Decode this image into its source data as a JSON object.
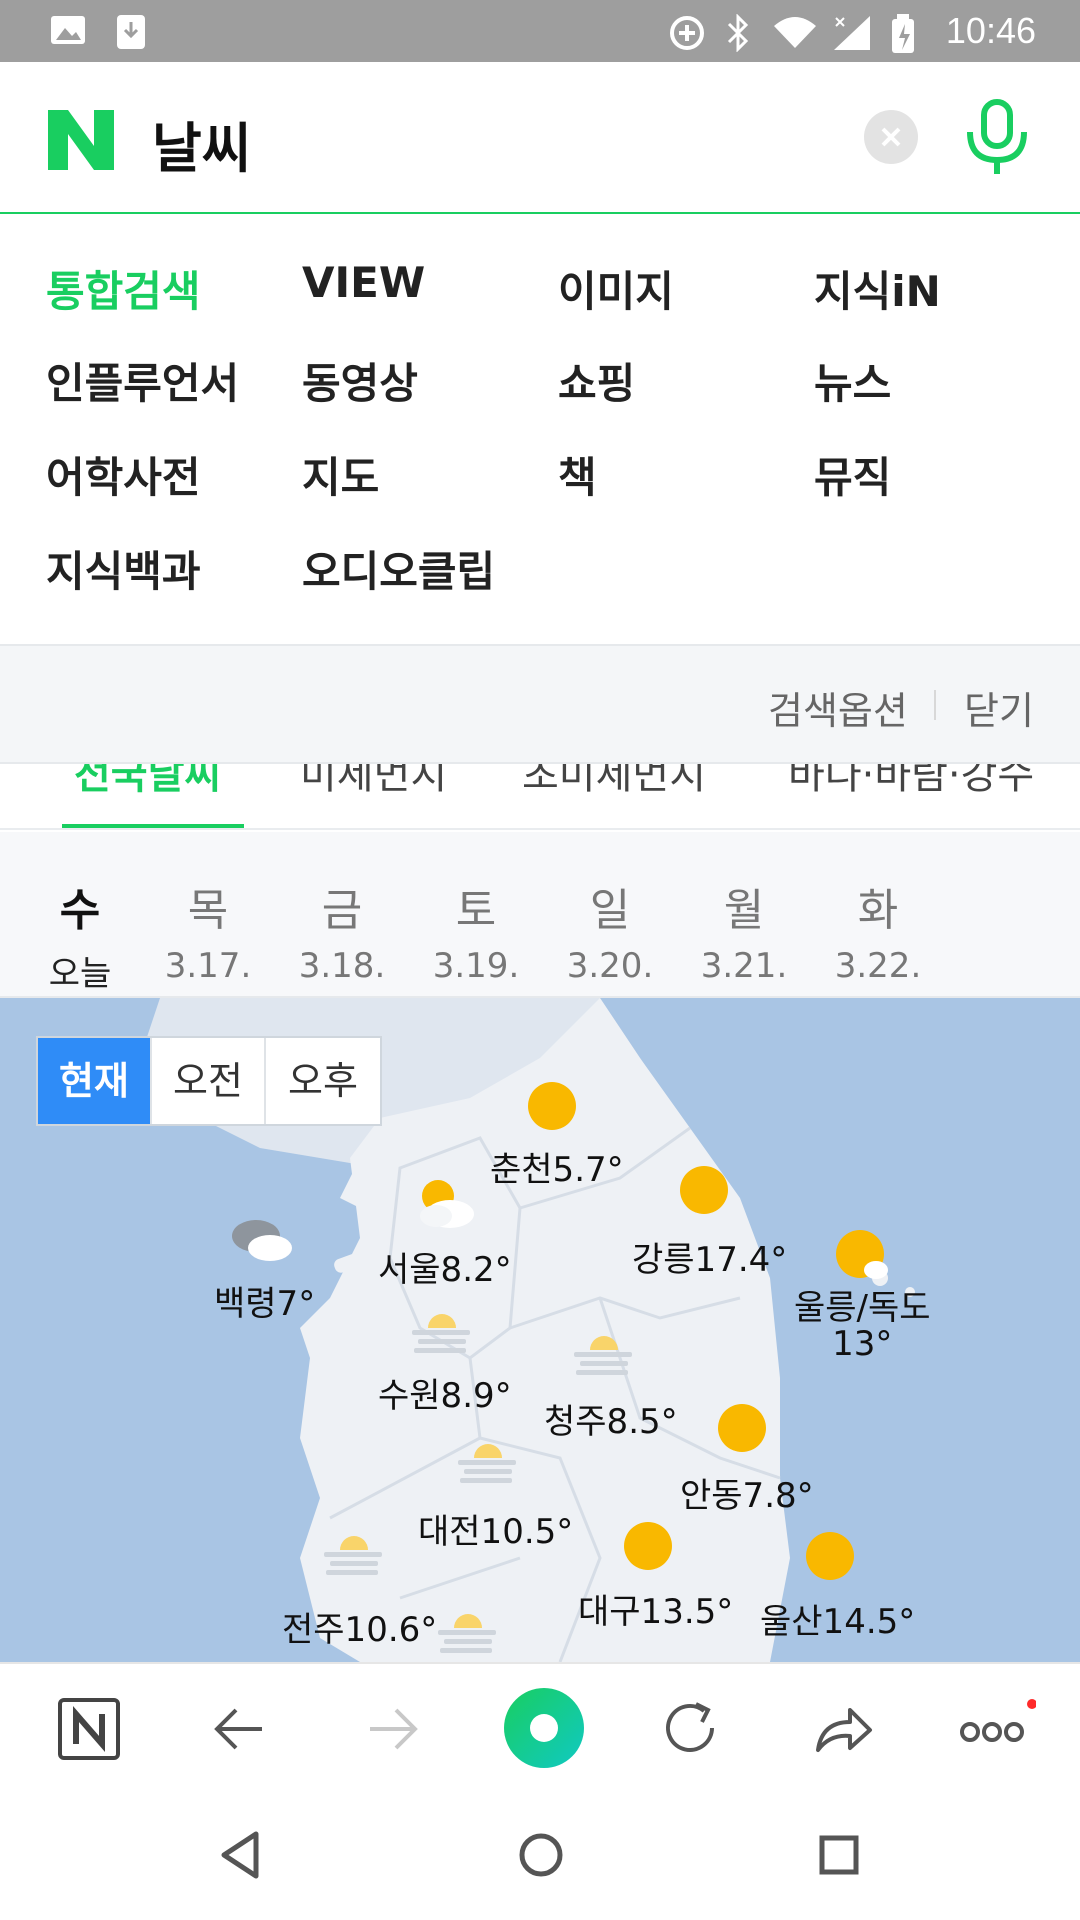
{
  "status_bar": {
    "time": "10:46"
  },
  "search": {
    "query": "날씨"
  },
  "categories": [
    {
      "label": "통합검색",
      "active": true
    },
    {
      "label": "VIEW"
    },
    {
      "label": "이미지"
    },
    {
      "label": "지식iN"
    },
    {
      "label": "인플루언서"
    },
    {
      "label": "동영상"
    },
    {
      "label": "쇼핑"
    },
    {
      "label": "뉴스"
    },
    {
      "label": "어학사전"
    },
    {
      "label": "지도"
    },
    {
      "label": "책"
    },
    {
      "label": "뮤직"
    },
    {
      "label": "지식백과"
    },
    {
      "label": "오디오클립"
    }
  ],
  "options": {
    "search_options": "검색옵션",
    "close": "닫기"
  },
  "tabs": [
    "전국날씨",
    "미세먼지",
    "초미세먼지",
    "바다·바람·강수"
  ],
  "days": [
    {
      "dow": "수",
      "date": "오늘"
    },
    {
      "dow": "목",
      "date": "3.17."
    },
    {
      "dow": "금",
      "date": "3.18."
    },
    {
      "dow": "토",
      "date": "3.19."
    },
    {
      "dow": "일",
      "date": "3.20."
    },
    {
      "dow": "월",
      "date": "3.21."
    },
    {
      "dow": "화",
      "date": "3.22."
    }
  ],
  "time_toggle": [
    "현재",
    "오전",
    "오후"
  ],
  "cities": [
    {
      "name": "춘천5.7°",
      "icon": "sun-icon"
    },
    {
      "name": "강릉17.4°",
      "icon": "sun-icon"
    },
    {
      "name": "서울8.2°",
      "icon": "partly-cloudy-icon"
    },
    {
      "name": "백령7°",
      "icon": "cloud-icon"
    },
    {
      "name": "울릉/독도",
      "name2": "13°",
      "icon": "sun-icon"
    },
    {
      "name": "수원8.9°",
      "icon": "haze-icon"
    },
    {
      "name": "청주8.5°",
      "icon": "haze-icon"
    },
    {
      "name": "안동7.8°",
      "icon": "sun-icon"
    },
    {
      "name": "대전10.5°",
      "icon": "haze-icon"
    },
    {
      "name": "대구13.5°",
      "icon": "sun-icon"
    },
    {
      "name": "울산14.5°",
      "icon": "sun-icon"
    },
    {
      "name": "전주10.6°",
      "icon": "haze-icon"
    }
  ],
  "colors": {
    "brand_green": "#19ce60",
    "toggle_blue": "#2f8cf7",
    "sun": "#f9b800",
    "sea": "#a9c5e4",
    "land": "#eef1f5"
  }
}
